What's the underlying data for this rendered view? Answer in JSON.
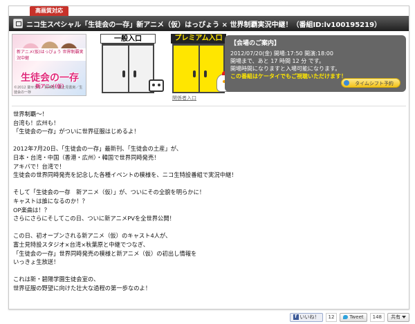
{
  "badge": "高画質対応",
  "title": "ニコ生スペシャル「生徒会の一存」新アニメ（仮）はっぴょう × 世界制覇実況中継！（番組ID:lv100195219）",
  "thumbnail": {
    "tag": "新アニメ(仮)はっぴょう 世界制覇実況中継",
    "logo": "生徒会の一存",
    "sub": "新アニメ(仮)",
    "copy": "©2012 葵せきな・狗神煌／富士見書房／生徒会の一存"
  },
  "doors": {
    "general_label": "一般入口",
    "premium_label": "プレミアム入口",
    "link": "関係者入口"
  },
  "info": {
    "heading": "【会場のご案内】",
    "date": "2012/07/20(金) 開場:17:50 開演:18:00",
    "lines": [
      "開場まで、あと 17 時間 12 分 です。",
      "開場時間になりますと入場可能になります。"
    ],
    "keitai": "この番組はケータイでもご視聴いただけます！",
    "timeshift_button": "タイムシフト予約"
  },
  "description": [
    "世界制覇～！",
    "台湾も！広州も！",
    "「生徒会の一存」がついに世界征服はじめるよ！",
    "",
    "2012年7月20日、「生徒会の一存」最新刊、「生徒会の土産」が、",
    "日本・台湾・中国（香港・広州）・韓国で世界同時発売！",
    "アキバで！台湾で！",
    "生徒会の世界同時発売を記念した各種イベントの模様を、ニコ生特設番組で実況中継！",
    "",
    "そして「生徒会の一存　新アニメ（仮）」が、ついにその全貌を明らかに！",
    "キャストは誰になるのか！？",
    "OP楽曲は！？",
    "さらにさらにそしてこの日、ついに新アニメPVを全世界公開！",
    "",
    "この日、初オープンされる新アニメ（仮）のキャスト4人が、",
    "富士見特設スタジオ×台湾×秋葉原と中継でつなぎ、",
    "「生徒会の一存」世界同時発売の模様と新アニメ（仮）の初出し情報を",
    "いっきょ生放送！",
    "",
    "これは新・碧陽学園生徒会室の、",
    "世界征服の野望に向けた壮大な過程の第一歩なのよ！"
  ],
  "social": {
    "like_label": "いいね！",
    "like_count": "12",
    "tweet_label": "Tweet",
    "tweet_count": "148",
    "share_label": "共有"
  }
}
